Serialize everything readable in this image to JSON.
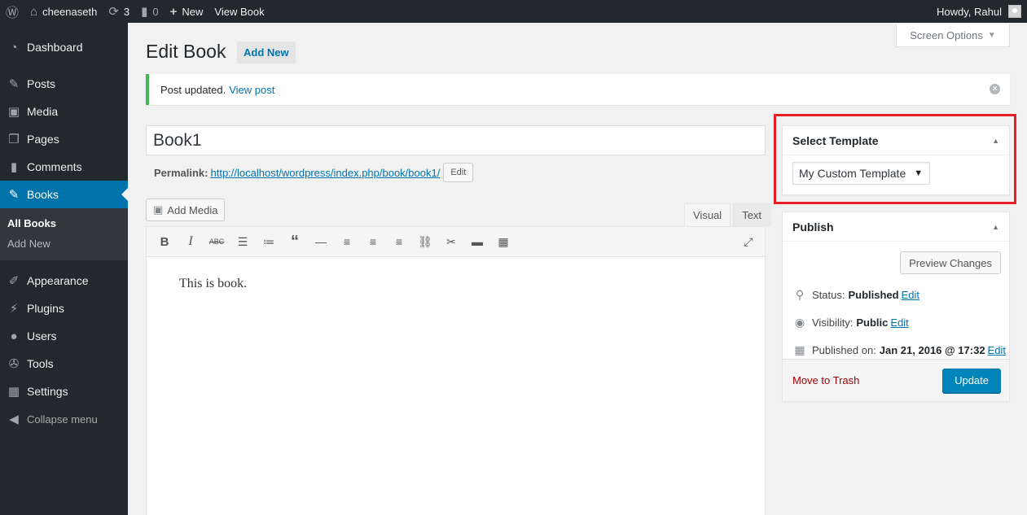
{
  "adminbar": {
    "site_name": "cheenaseth",
    "updates_count": "3",
    "comments_count": "0",
    "new_label": "New",
    "view_label": "View Book",
    "howdy": "Howdy, Rahul"
  },
  "sidebar": {
    "dashboard": "Dashboard",
    "posts": "Posts",
    "media": "Media",
    "pages": "Pages",
    "comments": "Comments",
    "books": "Books",
    "all_books": "All Books",
    "add_new": "Add New",
    "appearance": "Appearance",
    "plugins": "Plugins",
    "users": "Users",
    "tools": "Tools",
    "settings": "Settings",
    "collapse": "Collapse menu"
  },
  "header": {
    "title": "Edit Book",
    "add_new": "Add New",
    "screen_options": "Screen Options"
  },
  "notice": {
    "text": "Post updated.",
    "link": "View post"
  },
  "post": {
    "title": "Book1",
    "permalink_label": "Permalink:",
    "permalink_url": "http://localhost/wordpress/index.php/book/book1/",
    "edit_label": "Edit",
    "content": "This is book."
  },
  "editor": {
    "add_media": "Add Media",
    "tab_visual": "Visual",
    "tab_text": "Text",
    "strike_text": "ABC"
  },
  "template_box": {
    "title": "Select Template",
    "selected": "My Custom Template"
  },
  "publish": {
    "title": "Publish",
    "preview": "Preview Changes",
    "status_label": "Status:",
    "status_value": "Published",
    "visibility_label": "Visibility:",
    "visibility_value": "Public",
    "published_label": "Published on:",
    "published_value": "Jan 21, 2016 @ 17:32",
    "edit": "Edit",
    "trash": "Move to Trash",
    "update": "Update"
  },
  "colors": {
    "primary": "#0085ba",
    "active_menu": "#0073aa",
    "highlight": "#e81e25",
    "notice_success": "#46b450"
  }
}
